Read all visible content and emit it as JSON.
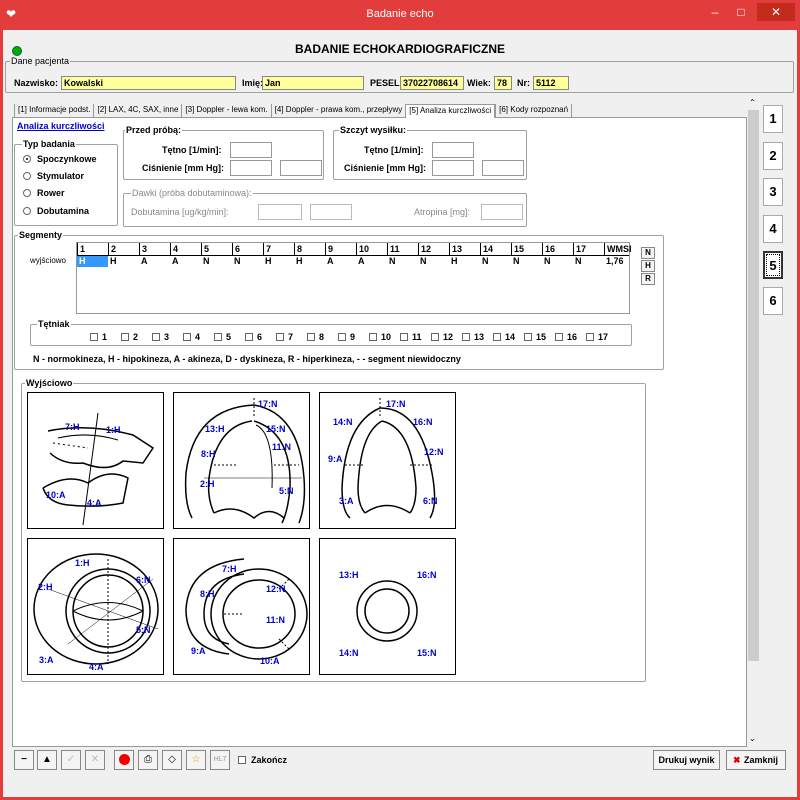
{
  "window": {
    "title": "Badanie echo",
    "minimize": "–",
    "maximize": "□",
    "close": "✕"
  },
  "form_title": "BADANIE ECHOKARDIOGRAFICZNE",
  "patient": {
    "group_label": "Dane pacjenta",
    "surname_label": "Nazwisko:",
    "surname": "Kowalski",
    "name_label": "Imię:",
    "name": "Jan",
    "pesel_label": "PESEL:",
    "pesel": "37022708614",
    "age_label": "Wiek:",
    "age": "78",
    "nr_label": "Nr:",
    "nr": "5112"
  },
  "tabs": [
    "[1] Informacje podst.",
    "[2] LAX, 4C, SAX, inne",
    "[3] Doppler - lewa kom.",
    "[4] Doppler - prawa kom., przepływy",
    "[5] Analiza kurczliwości",
    "[6] Kody rozpoznań"
  ],
  "active_tab": 4,
  "section_link": "Analiza kurczliwości",
  "study_type": {
    "label": "Typ badania",
    "options": [
      "Spoczynkowe",
      "Stymulator",
      "Rower",
      "Dobutamina"
    ],
    "selected": 0
  },
  "before": {
    "label": "Przed próbą:",
    "pulse_label": "Tętno [1/min]:",
    "pressure_label": "Ciśnienie [mm Hg]:"
  },
  "peak": {
    "label": "Szczyt wysiłku:",
    "pulse_label": "Tętno [1/min]:",
    "pressure_label": "Ciśnienie [mm Hg]:"
  },
  "doses": {
    "label": "Dawki (próba dobutaminowa):",
    "dobutamine_label": "Dobutamina [ug/kg/min]:",
    "atropine_label": "Atropina [mg]:"
  },
  "segments": {
    "label": "Segmenty",
    "columns": [
      "1",
      "2",
      "3",
      "4",
      "5",
      "6",
      "7",
      "8",
      "9",
      "10",
      "11",
      "12",
      "13",
      "14",
      "15",
      "16",
      "17",
      "WMSI"
    ],
    "row_label": "wyjściowo",
    "row_values": [
      "H",
      "H",
      "A",
      "A",
      "N",
      "N",
      "H",
      "H",
      "A",
      "A",
      "N",
      "N",
      "H",
      "N",
      "N",
      "N",
      "N",
      "1,76"
    ],
    "side_buttons": [
      "N",
      "H",
      "R"
    ],
    "aneurysm_label": "Tętniak",
    "aneurysm_items": [
      "1",
      "2",
      "3",
      "4",
      "5",
      "6",
      "7",
      "8",
      "9",
      "10",
      "11",
      "12",
      "13",
      "14",
      "15",
      "16",
      "17"
    ],
    "legend": "N - normokineza, H - hipokineza, A - akineza, D - dyskineza, R - hiperkineza, - - segment niewidoczny"
  },
  "diagrams": {
    "label": "Wyjściowo",
    "d1": [
      "7:H",
      "1:H",
      "10:A",
      "4:A"
    ],
    "d2": [
      "17:N",
      "13:H",
      "15:N",
      "11:N",
      "8:H",
      "2:H",
      "5:N"
    ],
    "d3": [
      "17:N",
      "14:N",
      "16:N",
      "12:N",
      "9:A",
      "3:A",
      "6:N"
    ],
    "d4": [
      "1:H",
      "2:H",
      "6:N",
      "5:N",
      "3:A",
      "4:A"
    ],
    "d5": [
      "7:H",
      "8:H",
      "12:N",
      "11:N",
      "9:A",
      "10:A"
    ],
    "d6": [
      "13:H",
      "16:N",
      "14:N",
      "15:N"
    ]
  },
  "side_tabs": [
    "1",
    "2",
    "3",
    "4",
    "5",
    "6"
  ],
  "side_tab_selected": 4,
  "toolbar": {
    "finish_label": "Zakończ",
    "print_label": "Drukuj wynik",
    "close_label": "Zamknij",
    "hl7": "HL7"
  },
  "colors": {
    "titlebar": "#e33c3c",
    "highlight": "#ffff99",
    "segment_text": "#0000cc",
    "selected_cell": "#3399ff"
  }
}
